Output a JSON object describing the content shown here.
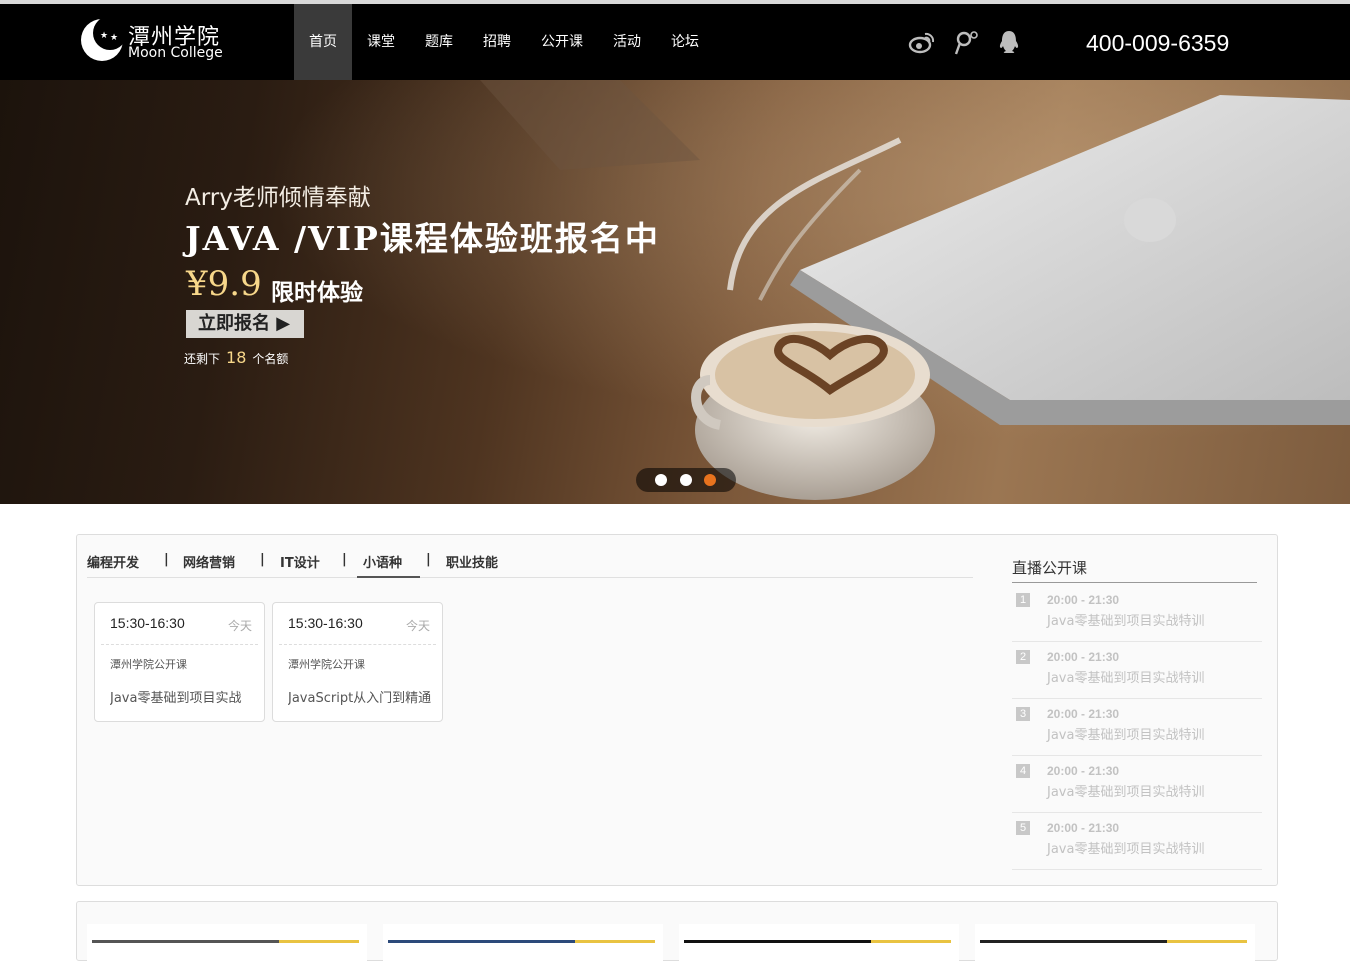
{
  "logo": {
    "cn": "潭州学院",
    "en": "Moon College"
  },
  "nav": {
    "items": [
      {
        "label": "首页",
        "active": true
      },
      {
        "label": "课堂",
        "active": false
      },
      {
        "label": "题库",
        "active": false
      },
      {
        "label": "招聘",
        "active": false
      },
      {
        "label": "公开课",
        "active": false
      },
      {
        "label": "活动",
        "active": false
      },
      {
        "label": "论坛",
        "active": false
      }
    ]
  },
  "social": {
    "icons": [
      "weibo-icon",
      "tencent-weibo-icon",
      "qq-icon"
    ]
  },
  "phone": "400-009-6359",
  "banner": {
    "subtitle": "Arry老师倾情奉献",
    "title": "JAVA /VIP课程体验班报名中",
    "price": "¥9.9",
    "limit": "限时体验",
    "button": "立即报名 ▶",
    "remain_prefix": "还剩下",
    "remain_count": "18",
    "remain_suffix": "个名额",
    "active_slide": 3,
    "slide_count": 3
  },
  "courses": {
    "tabs": [
      {
        "label": "编程开发",
        "active": false
      },
      {
        "label": "网络营销",
        "active": false
      },
      {
        "label": "IT设计",
        "active": false
      },
      {
        "label": "小语种",
        "active": true
      },
      {
        "label": "职业技能",
        "active": false
      }
    ],
    "separator": "|",
    "cards": [
      {
        "time": "15:30-16:30",
        "day": "今天",
        "org": "潭州学院公开课",
        "course": "Java零基础到项目实战"
      },
      {
        "time": "15:30-16:30",
        "day": "今天",
        "org": "潭州学院公开课",
        "course": "JavaScript从入门到精通"
      }
    ]
  },
  "live": {
    "title": "直播公开课",
    "items": [
      {
        "index": "1",
        "time": "20:00 - 21:30",
        "course": "Java零基础到项目实战特训"
      },
      {
        "index": "2",
        "time": "20:00 - 21:30",
        "course": "Java零基础到项目实战特训"
      },
      {
        "index": "3",
        "time": "20:00 - 21:30",
        "course": "Java零基础到项目实战特训"
      },
      {
        "index": "4",
        "time": "20:00 - 21:30",
        "course": "Java零基础到项目实战特训"
      },
      {
        "index": "5",
        "time": "20:00 - 21:30",
        "course": "Java零基础到项目实战特训"
      }
    ]
  },
  "colors": {
    "header_bg": "#000000",
    "accent_orange": "#e8731e",
    "price_gold": "#f7d78a"
  }
}
